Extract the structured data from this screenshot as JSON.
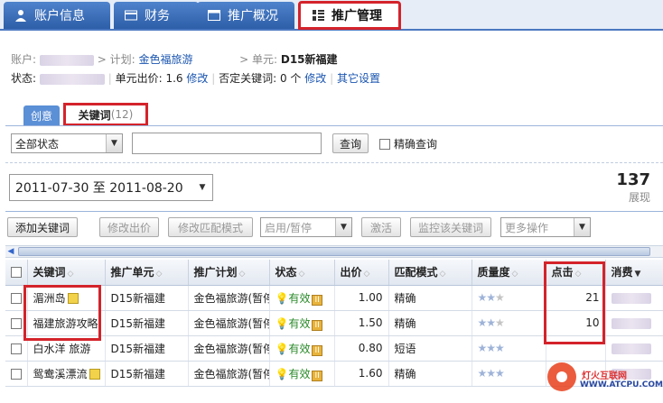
{
  "nav": {
    "tabs": [
      {
        "label": "账户信息",
        "icon": "user-icon"
      },
      {
        "label": "财务",
        "icon": "card-icon"
      },
      {
        "label": "推广概况",
        "icon": "window-icon"
      },
      {
        "label": "推广管理",
        "icon": "grid-icon",
        "active": true
      }
    ]
  },
  "breadcrumb": {
    "account_label": "账户:",
    "plan_label": "> 计划:",
    "plan_value": "金色福旅游",
    "unit_label": "> 单元:",
    "unit_value": "D15新福建"
  },
  "status_row": {
    "status_label": "状态:",
    "bid_label": "单元出价:",
    "bid_value": "1.6",
    "bid_edit": "修改",
    "neg_label": "否定关键词:",
    "neg_value": "0 个",
    "neg_edit": "修改",
    "other_settings": "其它设置"
  },
  "subtabs": {
    "creative": "创意",
    "keywords": "关键词",
    "keywords_count": "(12)"
  },
  "filter": {
    "status_select": "全部状态",
    "search_button": "查询",
    "exact_label": "精确查询"
  },
  "date_range": "2011-07-30 至 2011-08-20",
  "impressions": {
    "value": "137",
    "label": "展现"
  },
  "toolbar": {
    "add_keyword": "添加关键词",
    "edit_bid": "修改出价",
    "edit_match": "修改匹配模式",
    "enable_pause": "启用/暂停",
    "activate": "激活",
    "monitor": "监控该关键词",
    "more": "更多操作"
  },
  "table": {
    "headers": [
      "关键词",
      "推广单元",
      "推广计划",
      "状态",
      "出价",
      "匹配模式",
      "质量度",
      "点击",
      "消费"
    ],
    "rows": [
      {
        "keyword": "湄洲岛",
        "unit": "D15新福建",
        "plan": "金色福旅游(暂停)",
        "status": "有效",
        "bid": "1.00",
        "match": "精确",
        "stars": 2,
        "clicks": "21"
      },
      {
        "keyword": "福建旅游攻略",
        "unit": "D15新福建",
        "plan": "金色福旅游(暂停)",
        "status": "有效",
        "bid": "1.50",
        "match": "精确",
        "stars": 2,
        "clicks": "10"
      },
      {
        "keyword": "白水洋 旅游",
        "unit": "D15新福建",
        "plan": "金色福旅游(暂停)",
        "status": "有效",
        "bid": "0.80",
        "match": "短语",
        "stars": 3,
        "clicks": ""
      },
      {
        "keyword": "鸳鸯溪漂流",
        "unit": "D15新福建",
        "plan": "金色福旅游(暂停)",
        "status": "有效",
        "bid": "1.60",
        "match": "精确",
        "stars": 3,
        "clicks": ""
      }
    ]
  },
  "watermark": {
    "brand": "灯火互联网",
    "url": "WWW.ATCPU.COM"
  },
  "colors": {
    "accent": "#2d5ea8",
    "highlight": "#d4232b",
    "link": "#1a55b0",
    "ok": "#2a8a2a"
  }
}
